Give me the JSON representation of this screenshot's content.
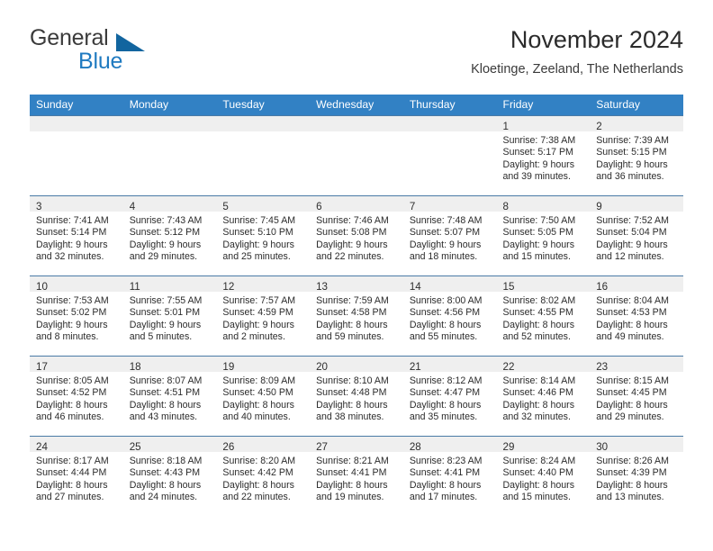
{
  "brand": {
    "name_part1": "General",
    "name_part2": "Blue",
    "triangle_color": "#12659f",
    "blue_color": "#1f7ac0"
  },
  "header": {
    "title": "November 2024",
    "subtitle": "Kloetinge, Zeeland, The Netherlands"
  },
  "theme": {
    "header_row_bg": "#3281c4",
    "daynum_band_bg": "#efefef",
    "row_border": "#4a7ba6"
  },
  "weekdays": [
    "Sunday",
    "Monday",
    "Tuesday",
    "Wednesday",
    "Thursday",
    "Friday",
    "Saturday"
  ],
  "weeks": [
    [
      {
        "day": "",
        "lines": []
      },
      {
        "day": "",
        "lines": []
      },
      {
        "day": "",
        "lines": []
      },
      {
        "day": "",
        "lines": []
      },
      {
        "day": "",
        "lines": []
      },
      {
        "day": "1",
        "lines": [
          "Sunrise: 7:38 AM",
          "Sunset: 5:17 PM",
          "Daylight: 9 hours",
          "and 39 minutes."
        ]
      },
      {
        "day": "2",
        "lines": [
          "Sunrise: 7:39 AM",
          "Sunset: 5:15 PM",
          "Daylight: 9 hours",
          "and 36 minutes."
        ]
      }
    ],
    [
      {
        "day": "3",
        "lines": [
          "Sunrise: 7:41 AM",
          "Sunset: 5:14 PM",
          "Daylight: 9 hours",
          "and 32 minutes."
        ]
      },
      {
        "day": "4",
        "lines": [
          "Sunrise: 7:43 AM",
          "Sunset: 5:12 PM",
          "Daylight: 9 hours",
          "and 29 minutes."
        ]
      },
      {
        "day": "5",
        "lines": [
          "Sunrise: 7:45 AM",
          "Sunset: 5:10 PM",
          "Daylight: 9 hours",
          "and 25 minutes."
        ]
      },
      {
        "day": "6",
        "lines": [
          "Sunrise: 7:46 AM",
          "Sunset: 5:08 PM",
          "Daylight: 9 hours",
          "and 22 minutes."
        ]
      },
      {
        "day": "7",
        "lines": [
          "Sunrise: 7:48 AM",
          "Sunset: 5:07 PM",
          "Daylight: 9 hours",
          "and 18 minutes."
        ]
      },
      {
        "day": "8",
        "lines": [
          "Sunrise: 7:50 AM",
          "Sunset: 5:05 PM",
          "Daylight: 9 hours",
          "and 15 minutes."
        ]
      },
      {
        "day": "9",
        "lines": [
          "Sunrise: 7:52 AM",
          "Sunset: 5:04 PM",
          "Daylight: 9 hours",
          "and 12 minutes."
        ]
      }
    ],
    [
      {
        "day": "10",
        "lines": [
          "Sunrise: 7:53 AM",
          "Sunset: 5:02 PM",
          "Daylight: 9 hours",
          "and 8 minutes."
        ]
      },
      {
        "day": "11",
        "lines": [
          "Sunrise: 7:55 AM",
          "Sunset: 5:01 PM",
          "Daylight: 9 hours",
          "and 5 minutes."
        ]
      },
      {
        "day": "12",
        "lines": [
          "Sunrise: 7:57 AM",
          "Sunset: 4:59 PM",
          "Daylight: 9 hours",
          "and 2 minutes."
        ]
      },
      {
        "day": "13",
        "lines": [
          "Sunrise: 7:59 AM",
          "Sunset: 4:58 PM",
          "Daylight: 8 hours",
          "and 59 minutes."
        ]
      },
      {
        "day": "14",
        "lines": [
          "Sunrise: 8:00 AM",
          "Sunset: 4:56 PM",
          "Daylight: 8 hours",
          "and 55 minutes."
        ]
      },
      {
        "day": "15",
        "lines": [
          "Sunrise: 8:02 AM",
          "Sunset: 4:55 PM",
          "Daylight: 8 hours",
          "and 52 minutes."
        ]
      },
      {
        "day": "16",
        "lines": [
          "Sunrise: 8:04 AM",
          "Sunset: 4:53 PM",
          "Daylight: 8 hours",
          "and 49 minutes."
        ]
      }
    ],
    [
      {
        "day": "17",
        "lines": [
          "Sunrise: 8:05 AM",
          "Sunset: 4:52 PM",
          "Daylight: 8 hours",
          "and 46 minutes."
        ]
      },
      {
        "day": "18",
        "lines": [
          "Sunrise: 8:07 AM",
          "Sunset: 4:51 PM",
          "Daylight: 8 hours",
          "and 43 minutes."
        ]
      },
      {
        "day": "19",
        "lines": [
          "Sunrise: 8:09 AM",
          "Sunset: 4:50 PM",
          "Daylight: 8 hours",
          "and 40 minutes."
        ]
      },
      {
        "day": "20",
        "lines": [
          "Sunrise: 8:10 AM",
          "Sunset: 4:48 PM",
          "Daylight: 8 hours",
          "and 38 minutes."
        ]
      },
      {
        "day": "21",
        "lines": [
          "Sunrise: 8:12 AM",
          "Sunset: 4:47 PM",
          "Daylight: 8 hours",
          "and 35 minutes."
        ]
      },
      {
        "day": "22",
        "lines": [
          "Sunrise: 8:14 AM",
          "Sunset: 4:46 PM",
          "Daylight: 8 hours",
          "and 32 minutes."
        ]
      },
      {
        "day": "23",
        "lines": [
          "Sunrise: 8:15 AM",
          "Sunset: 4:45 PM",
          "Daylight: 8 hours",
          "and 29 minutes."
        ]
      }
    ],
    [
      {
        "day": "24",
        "lines": [
          "Sunrise: 8:17 AM",
          "Sunset: 4:44 PM",
          "Daylight: 8 hours",
          "and 27 minutes."
        ]
      },
      {
        "day": "25",
        "lines": [
          "Sunrise: 8:18 AM",
          "Sunset: 4:43 PM",
          "Daylight: 8 hours",
          "and 24 minutes."
        ]
      },
      {
        "day": "26",
        "lines": [
          "Sunrise: 8:20 AM",
          "Sunset: 4:42 PM",
          "Daylight: 8 hours",
          "and 22 minutes."
        ]
      },
      {
        "day": "27",
        "lines": [
          "Sunrise: 8:21 AM",
          "Sunset: 4:41 PM",
          "Daylight: 8 hours",
          "and 19 minutes."
        ]
      },
      {
        "day": "28",
        "lines": [
          "Sunrise: 8:23 AM",
          "Sunset: 4:41 PM",
          "Daylight: 8 hours",
          "and 17 minutes."
        ]
      },
      {
        "day": "29",
        "lines": [
          "Sunrise: 8:24 AM",
          "Sunset: 4:40 PM",
          "Daylight: 8 hours",
          "and 15 minutes."
        ]
      },
      {
        "day": "30",
        "lines": [
          "Sunrise: 8:26 AM",
          "Sunset: 4:39 PM",
          "Daylight: 8 hours",
          "and 13 minutes."
        ]
      }
    ]
  ]
}
